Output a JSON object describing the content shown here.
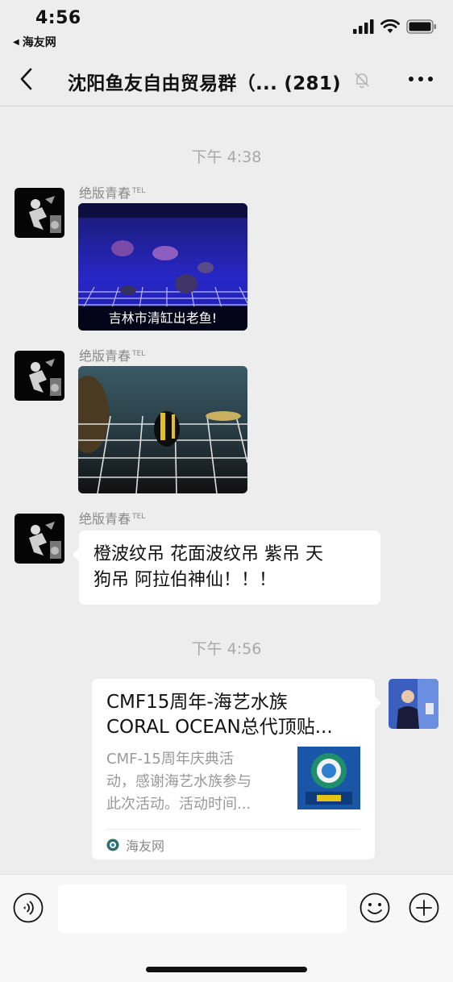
{
  "status_bar": {
    "time": "4:56",
    "back_app": "海友网"
  },
  "nav": {
    "title": "沈阳鱼友自由贸易群（... (281)"
  },
  "messages": {
    "timestamp_1": "下午 4:38",
    "msg1": {
      "sender": "绝版青春",
      "sender_tag": "TEL",
      "image_caption": "吉林市清缸出老鱼!"
    },
    "msg2": {
      "sender": "绝版青春",
      "sender_tag": "TEL"
    },
    "msg3": {
      "sender": "绝版青春",
      "sender_tag": "TEL",
      "line1": "橙波纹吊  花面波纹吊 紫吊 天",
      "line2": "狗吊  阿拉伯神仙！！！"
    },
    "timestamp_2": "下午 4:56",
    "link_card": {
      "title_line1": "CMF15周年-海艺水族",
      "title_line2": "CORAL OCEAN总代顶贴...",
      "desc_line1": "CMF-15周年庆典活",
      "desc_line2": "动，感谢海艺水族参与",
      "desc_line3": "此次活动。活动时间...",
      "source": "海友网"
    }
  },
  "input": {
    "value": ""
  },
  "icons": {
    "back": "chevron-left-icon",
    "mute": "bell-slash-icon",
    "more": "more-icon",
    "voice": "voice-icon",
    "emoji": "emoji-icon",
    "plus": "plus-icon"
  },
  "colors": {
    "background": "#ededed",
    "bubble": "#ffffff",
    "timestamp": "#a8a8a8",
    "card_desc": "#999999"
  }
}
